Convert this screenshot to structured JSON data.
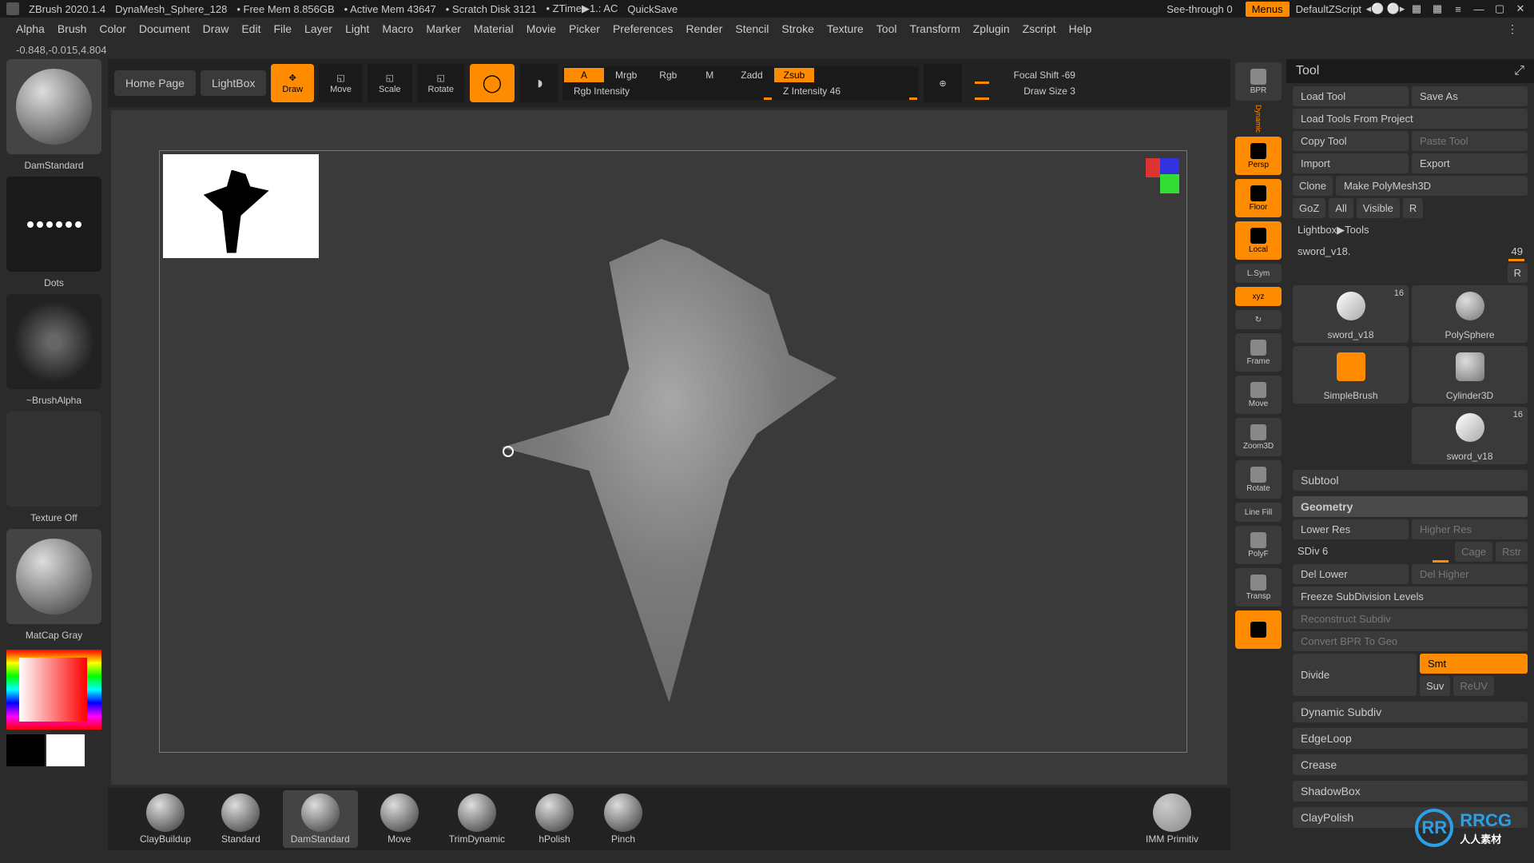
{
  "title_bar": {
    "app": "ZBrush 2020.1.4",
    "doc": "DynaMesh_Sphere_128",
    "freemem": "• Free Mem 8.856GB",
    "activemem": "• Active Mem 43647",
    "scratch": "• Scratch Disk 3121",
    "ztime": "• ZTime▶1.:  AC",
    "quicksave": "QuickSave",
    "seethrough": "See-through  0",
    "menus": "Menus",
    "zscript": "DefaultZScript"
  },
  "menu": [
    "Alpha",
    "Brush",
    "Color",
    "Document",
    "Draw",
    "Edit",
    "File",
    "Layer",
    "Light",
    "Macro",
    "Marker",
    "Material",
    "Movie",
    "Picker",
    "Preferences",
    "Render",
    "Stencil",
    "Stroke",
    "Texture",
    "Tool",
    "Transform",
    "Zplugin",
    "Zscript",
    "Help"
  ],
  "coords": "-0.848,-0.015,4.804",
  "top": {
    "home": "Home Page",
    "lightbox": "LightBox",
    "draw": "Draw",
    "move": "Move",
    "scale": "Scale",
    "rotate": "Rotate",
    "modes": {
      "a": "A",
      "mrgb": "Mrgb",
      "rgb": "Rgb",
      "m": "M",
      "zadd": "Zadd",
      "zsub": "Zsub"
    },
    "rgb_intensity": "Rgb Intensity",
    "z_intensity": "Z Intensity 46",
    "focal_shift": "Focal Shift -69",
    "draw_size": "Draw Size 3"
  },
  "left": {
    "brush": "DamStandard",
    "stroke": "Dots",
    "alpha": "~BrushAlpha",
    "texture": "Texture Off",
    "material": "MatCap Gray"
  },
  "right_sidebar": [
    "BPR",
    "Persp",
    "Floor",
    "Local",
    "L.Sym",
    "xyz",
    "",
    "Frame",
    "Move",
    "Zoom3D",
    "Rotate",
    "Line Fill",
    "PolyF",
    "Transp",
    ""
  ],
  "right_sidebar_orange": [
    false,
    true,
    true,
    true,
    false,
    true,
    false,
    false,
    false,
    false,
    false,
    false,
    false,
    false,
    true
  ],
  "right_sidebar_dynamic": "Dynamic",
  "shelf": [
    "ClayBuildup",
    "Standard",
    "DamStandard",
    "Move",
    "TrimDynamic",
    "hPolish",
    "Pinch",
    "IMM Primitiv"
  ],
  "shelf_active": 2,
  "tool": {
    "header": "Tool",
    "buttons": [
      [
        "Load Tool",
        "Save As"
      ],
      [
        "Load Tools From Project"
      ],
      [
        "Copy Tool",
        "Paste Tool"
      ],
      [
        "Import",
        "Export"
      ],
      [
        "Clone",
        "Make PolyMesh3D"
      ],
      [
        "GoZ",
        "All",
        "Visible",
        "R"
      ]
    ],
    "disabled": [
      "Paste Tool"
    ],
    "path": "Lightbox▶Tools",
    "current": {
      "name": "sword_v18.",
      "val": "49",
      "r": "R"
    },
    "thumbs": [
      {
        "label": "sword_v18",
        "badge": "16"
      },
      {
        "label": "PolySphere",
        "badge": ""
      },
      {
        "label": "SimpleBrush",
        "badge": ""
      },
      {
        "label": "Cylinder3D",
        "badge": ""
      },
      {
        "label": "",
        "badge": ""
      },
      {
        "label": "sword_v18",
        "badge": "16"
      }
    ],
    "sections": {
      "subtool": "Subtool",
      "geometry": "Geometry",
      "rows": [
        [
          "Lower Res",
          "Higher Res"
        ],
        [
          "Del Lower",
          "Del Higher"
        ]
      ],
      "sdiv": {
        "label": "SDiv 6",
        "cage": "Cage",
        "rstr": "Rstr"
      },
      "freeze": "Freeze SubDivision Levels",
      "recon": "Reconstruct Subdiv",
      "convert": "Convert BPR To Geo",
      "divide": "Divide",
      "smt": "Smt",
      "suv": "Suv",
      "reuv": "ReUV",
      "list": [
        "Dynamic Subdiv",
        "EdgeLoop",
        "Crease",
        "ShadowBox",
        "ClayPolish"
      ]
    }
  },
  "watermark": {
    "logo": "RR",
    "text1": "RRCG",
    "text2": "人人素材"
  },
  "chart_data": null
}
